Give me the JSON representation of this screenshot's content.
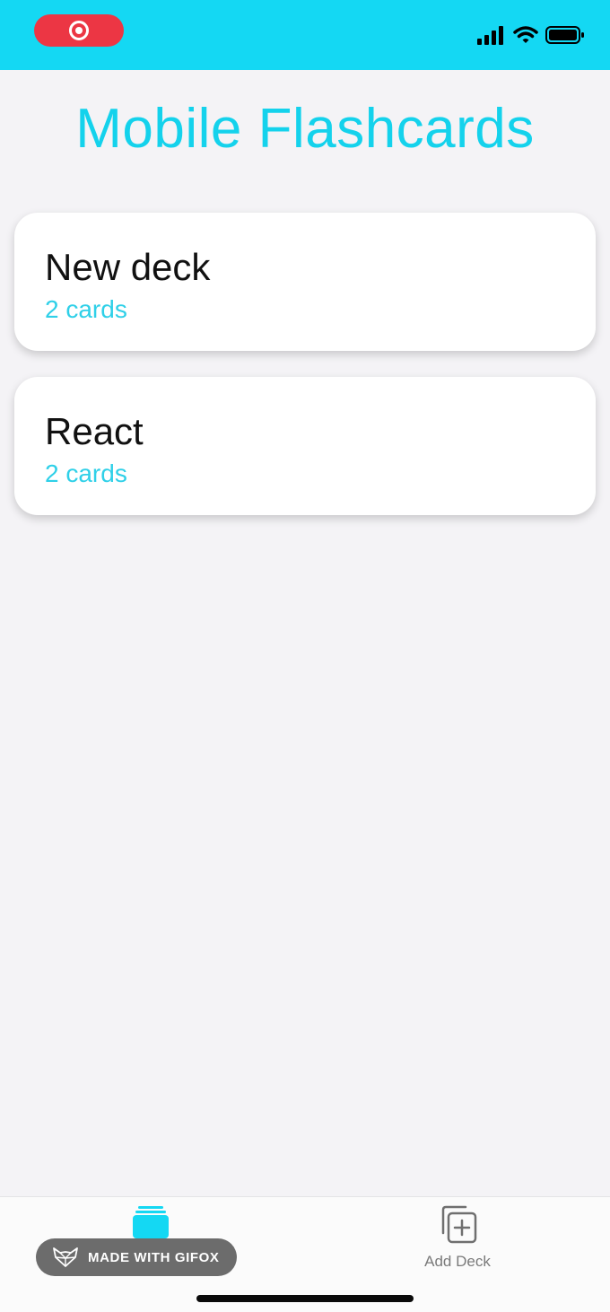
{
  "status_bar": {
    "record_icon": "record-icon",
    "icons": [
      "cellular-signal-icon",
      "wifi-icon",
      "battery-icon"
    ],
    "color": "#14d8f3"
  },
  "header": {
    "title": "Mobile Flashcards"
  },
  "decks": [
    {
      "title": "New deck",
      "count": "2 cards"
    },
    {
      "title": "React",
      "count": "2 cards"
    }
  ],
  "tab_bar": {
    "tabs": [
      {
        "icon": "deck-stack-icon",
        "label": "",
        "active": true
      },
      {
        "icon": "add-deck-icon",
        "label": "Add Deck",
        "active": false
      }
    ]
  },
  "watermark": {
    "text": "MADE WITH GIFOX",
    "icon": "fox-logo-icon"
  },
  "colors": {
    "accent": "#14d2ec",
    "count_text": "#2fd0e8",
    "record": "#ec3644"
  }
}
